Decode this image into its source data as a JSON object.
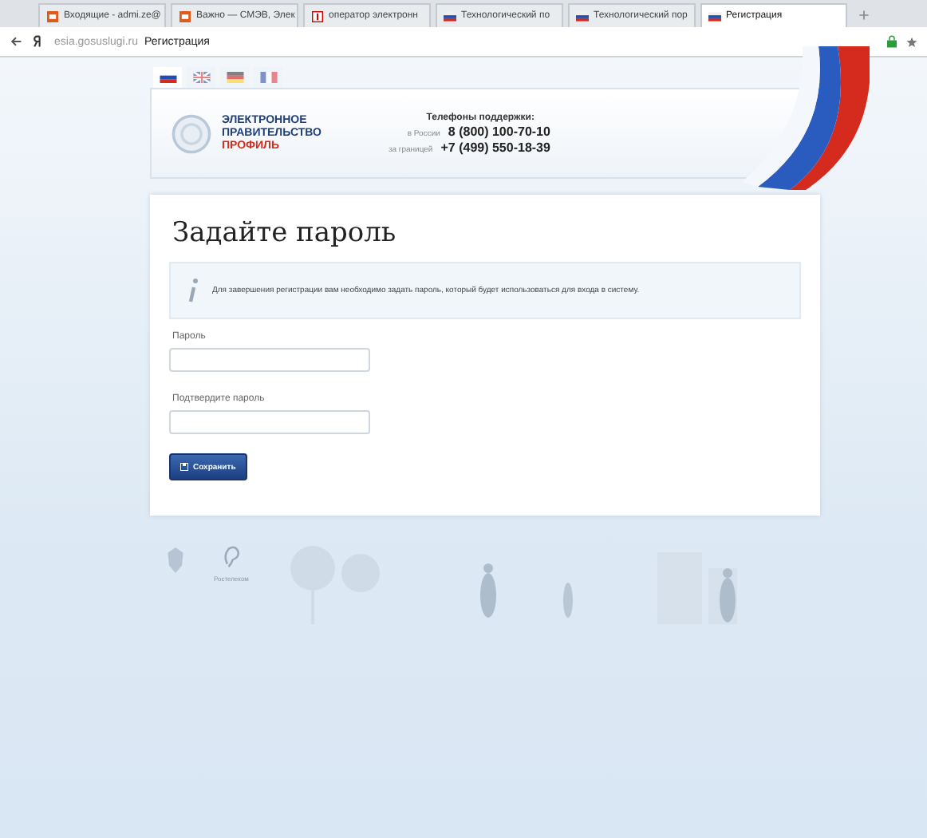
{
  "browser": {
    "tabs": [
      {
        "label": "Входящие - admi.ze@",
        "selected": false
      },
      {
        "label": "Важно — СМЭВ, Элек",
        "selected": false
      },
      {
        "label": "оператор электронн",
        "selected": false
      },
      {
        "label": "Технологический по",
        "selected": false
      },
      {
        "label": "Технологический пор",
        "selected": false
      },
      {
        "label": "Регистрация",
        "selected": true
      }
    ],
    "address_domain": "esia.gosuslugi.ru",
    "address_title": "Регистрация"
  },
  "languages": [
    {
      "selected": true
    },
    {
      "selected": false
    },
    {
      "selected": false
    },
    {
      "selected": false
    }
  ],
  "header": {
    "logo_lines": [
      "ЭЛЕКТРОННОЕ",
      "ПРАВИТЕЛЬСТВО"
    ],
    "logo_sub": "ПРОФИЛЬ",
    "support_title": "Телефоны поддержки:",
    "phones": [
      {
        "label": "в России",
        "number": "8 (800) 100-70-10"
      },
      {
        "label": "за границей",
        "number": "+7 (499) 550-18-39"
      }
    ]
  },
  "form": {
    "title": "Задайте пароль",
    "info": "Для завершения регистрации вам необходимо задать пароль, который будет использоваться для входа в систему.",
    "fields": [
      {
        "label": "Пароль"
      },
      {
        "label": "Подтвердите пароль"
      }
    ],
    "submit": "Сохранить"
  },
  "footer": {
    "partner": "Ростелеком"
  }
}
